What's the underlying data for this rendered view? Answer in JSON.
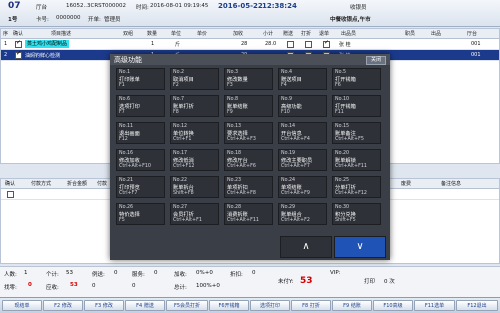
{
  "header": {
    "table_no": "07",
    "hall_label": "厅台",
    "order_no": "16052..3CRST000002",
    "time_label": "时间:",
    "time_value": "2016-08-01 09:19:45",
    "date_value": "2016-05-22",
    "clock": "12:38:24",
    "operator_label": "收银员",
    "customer_count": "1号",
    "card_label": "卡号:",
    "card_value": "0000000",
    "opener_label": "开单:",
    "opener_value": "管理员",
    "shift": "中餐收银点,午市"
  },
  "grid": {
    "columns": [
      "序",
      "确认",
      "项目描述",
      "",
      "",
      "双组",
      "数量",
      "单位",
      "单价",
      "加收",
      "小计",
      "赠送",
      "打折",
      "退单",
      "出品员",
      "职员",
      "出品",
      "厅台"
    ],
    "rows": [
      {
        "no": "1",
        "checked": true,
        "name": "蒸土鸡小鸡配制品",
        "qty": "1",
        "unit": "斤",
        "price": "28",
        "subtotal": "28.0",
        "extra_check": true,
        "staff": "张 桂",
        "hall": "001"
      },
      {
        "no": "2",
        "checked": true,
        "name": "油焖钓鲜心检测",
        "qty": "1",
        "unit": "斤",
        "price": "29",
        "subtotal": "",
        "extra_check": false,
        "staff": "张 桂",
        "hall": "001"
      }
    ]
  },
  "grid2": {
    "columns": [
      "确认",
      "付款方式",
      "折合金额",
      "付款",
      "",
      "",
      "",
      "",
      "",
      "",
      "",
      "",
      "",
      "废费",
      "备注信息"
    ]
  },
  "modal": {
    "title": "高级功能",
    "close_label": "关闭",
    "tiles": [
      {
        "l1": "No.1",
        "l2": "打印账单",
        "l3": "F1"
      },
      {
        "l1": "No.2",
        "l2": "取消项目",
        "l3": "F2"
      },
      {
        "l1": "No.3",
        "l2": "修改数量",
        "l3": "F3"
      },
      {
        "l1": "No.4",
        "l2": "赠送项目",
        "l3": "F4"
      },
      {
        "l1": "No.5",
        "l2": "打开钱箱",
        "l3": "F6"
      },
      {
        "l1": "No.6",
        "l2": "选项打印",
        "l3": "F7"
      },
      {
        "l1": "No.7",
        "l2": "账单打折",
        "l3": "F8"
      },
      {
        "l1": "No.8",
        "l2": "账单结账",
        "l3": "F9"
      },
      {
        "l1": "No.9",
        "l2": "高级功能",
        "l3": "F10"
      },
      {
        "l1": "No.10",
        "l2": "打开钱箱",
        "l3": "F11"
      },
      {
        "l1": "No.11",
        "l2": "退出画面",
        "l3": "F12"
      },
      {
        "l1": "No.12",
        "l2": "单位转换",
        "l3": "Ctrl+F1"
      },
      {
        "l1": "No.13",
        "l2": "要求选择",
        "l3": "Ctrl+Alt+F3"
      },
      {
        "l1": "No.14",
        "l2": "开台信息",
        "l3": "Ctrl+Alt+F4"
      },
      {
        "l1": "No.15",
        "l2": "账单备注",
        "l3": "Ctrl+Alt+F5"
      },
      {
        "l1": "No.16",
        "l2": "修改加收",
        "l3": "Ctrl+Alt+F10"
      },
      {
        "l1": "No.17",
        "l2": "修改低消",
        "l3": "Ctrl+F12"
      },
      {
        "l1": "No.18",
        "l2": "修改厅台",
        "l3": "Ctrl+Alt+F6"
      },
      {
        "l1": "No.19",
        "l2": "修改主要职员",
        "l3": "Ctrl+Alt+F7"
      },
      {
        "l1": "No.20",
        "l2": "账单解锁",
        "l3": "Ctrl+Alt+F11"
      },
      {
        "l1": "No.21",
        "l2": "打印预览",
        "l3": "Ctrl+F7"
      },
      {
        "l1": "No.22",
        "l2": "账单拆台",
        "l3": "Shift+F8"
      },
      {
        "l1": "No.23",
        "l2": "单项折扣",
        "l3": "Ctrl+Alt+F8"
      },
      {
        "l1": "No.24",
        "l2": "单项结账",
        "l3": "Ctrl+Alt+F9"
      },
      {
        "l1": "No.25",
        "l2": "分单打折",
        "l3": "Ctrl+Alt+F12"
      },
      {
        "l1": "No.26",
        "l2": "特价选择",
        "l3": "F5"
      },
      {
        "l1": "No.27",
        "l2": "会员打折",
        "l3": "Ctrl+Alt+F1"
      },
      {
        "l1": "No.28",
        "l2": "消费拆账",
        "l3": "Ctrl+Alt+F11"
      },
      {
        "l1": "No.29",
        "l2": "账单组合",
        "l3": "Ctrl+Alt+F2"
      },
      {
        "l1": "No.30",
        "l2": "积分兑换",
        "l3": "Shift+F5"
      }
    ],
    "nav_up": "∧",
    "nav_down": "∨"
  },
  "status": {
    "people_label": "人数:",
    "people": "1",
    "count_label": "个计:",
    "count": "53",
    "return_label": "例送:",
    "return": "0",
    "service_label": "服务:",
    "service": "0",
    "addon_label": "加收:",
    "addon": "0%+0",
    "discount_label": "折扣:",
    "discount": "0",
    "change_label": "找零:",
    "change": "0",
    "total_label": "总计:",
    "total_pct": "100%+0",
    "paid_label": "未付Y:",
    "paid": "53",
    "vip_label": "VIP:",
    "print_label": "打印",
    "print_count": "0 次",
    "amount_label": "应收:",
    "amount": "53",
    "m1": "0",
    "m2": "0"
  },
  "fkeys": [
    "现结单",
    "F2 修改",
    "F3 修改",
    "F4 赠送",
    "F5会员打折",
    "F6开钱箱",
    "选项打印",
    "F8 打折",
    "F9 结账",
    "F10高级",
    "F11选单",
    "F12退出"
  ],
  "colors": {
    "selected_row": "#1b3a8c",
    "highlight": "#33e0ee",
    "modal_bg": "#3a3f47",
    "accent_blue": "#2053b6",
    "red": "#d40000"
  }
}
